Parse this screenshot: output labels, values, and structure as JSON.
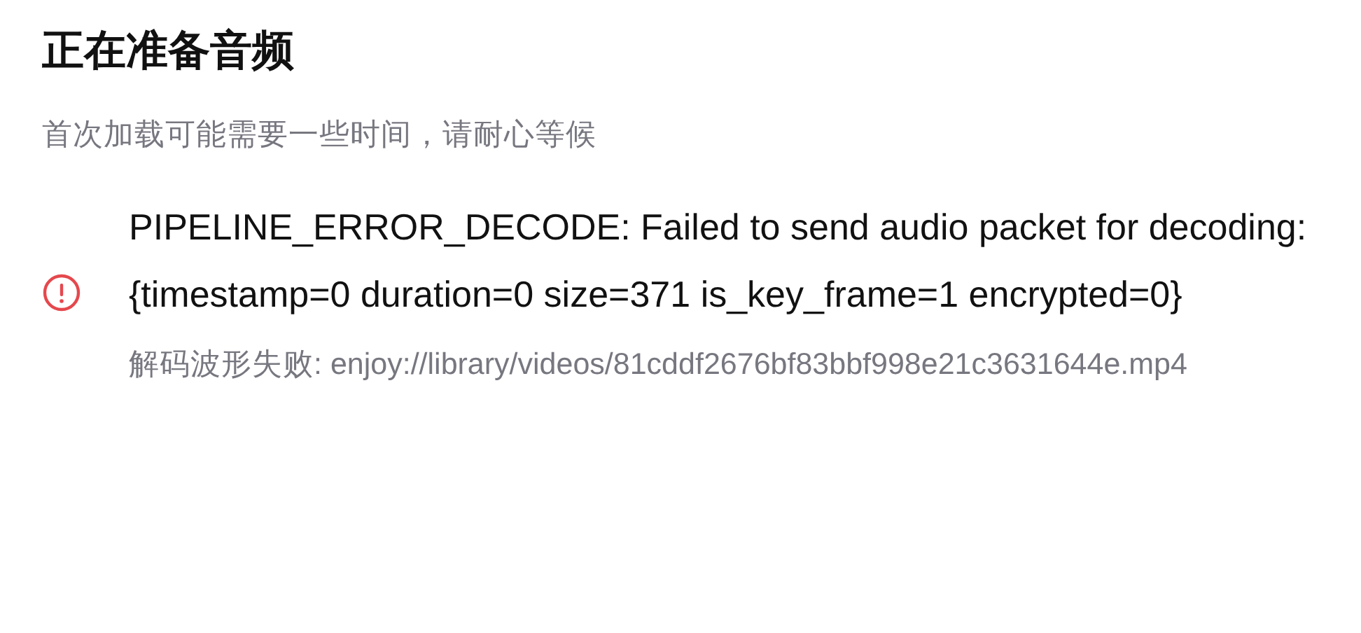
{
  "title": "正在准备音频",
  "subtitle": "首次加载可能需要一些时间，请耐心等候",
  "error": {
    "kind": "error",
    "message": "PIPELINE_ERROR_DECODE: Failed to send audio packet for decoding: {timestamp=0 duration=0 size=371 is_key_frame=1 encrypted=0}",
    "detail": "解码波形失败: enjoy://library/videos/81cddf2676bf83bbf998e21c3631644e.mp4"
  }
}
